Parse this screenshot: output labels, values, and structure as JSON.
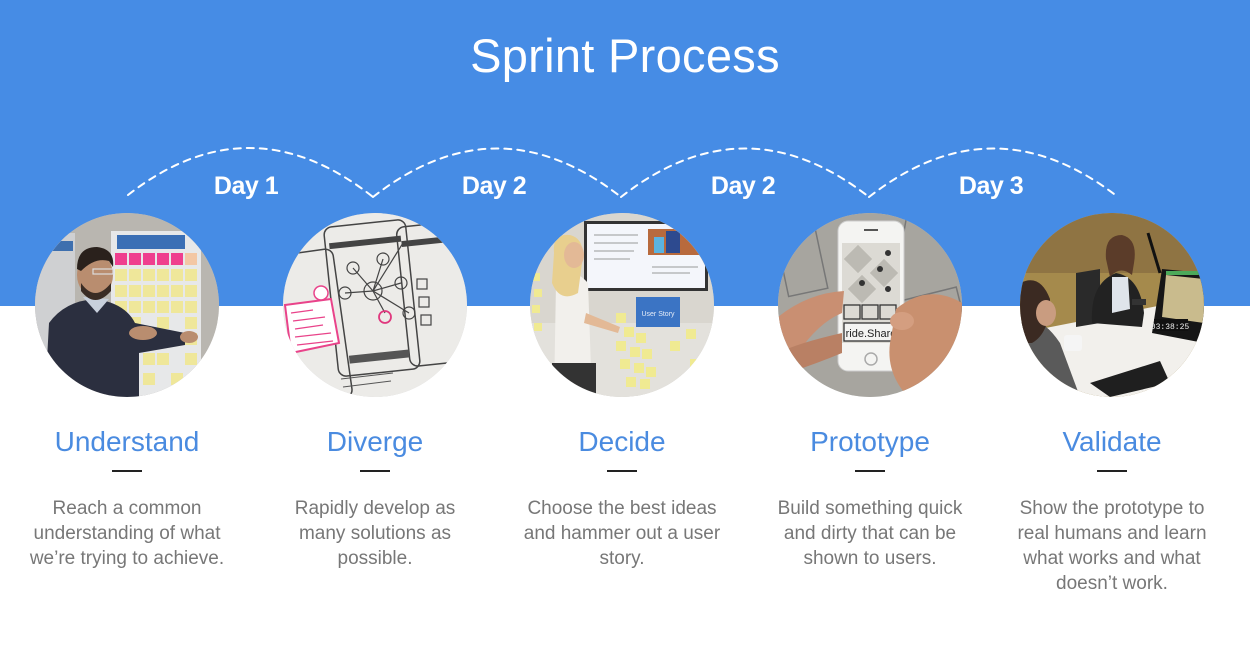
{
  "title": "Sprint Process",
  "colors": {
    "band": "#468ce5",
    "accent_text": "#4a8be0",
    "body_text": "#777777",
    "divider": "#222222",
    "label_text": "#ffffff"
  },
  "days": [
    {
      "label": "Day 1"
    },
    {
      "label": "Day 2"
    },
    {
      "label": "Day 2"
    },
    {
      "label": "Day 3"
    }
  ],
  "steps": [
    {
      "title": "Understand",
      "description": "Reach a common understanding of what we’re trying to achieve.",
      "photo": "person-presenting-sticky-notes-photo"
    },
    {
      "title": "Diverge",
      "description": "Rapidly develop as many solutions as possible.",
      "photo": "phone-sketches-photo"
    },
    {
      "title": "Decide",
      "description": "Choose the best ideas and hammer out a user story.",
      "photo": "user-story-wall-photo",
      "photo_text": "User Story"
    },
    {
      "title": "Prototype",
      "description": "Build something quick and dirty that can be shown to users.",
      "photo": "paper-prototype-phone-photo",
      "photo_text": "ride.Share"
    },
    {
      "title": "Validate",
      "description": "Show the prototype to real humans and learn what works and what doesn’t work.",
      "photo": "user-testing-session-photo",
      "photo_text": "03:38:25"
    }
  ]
}
